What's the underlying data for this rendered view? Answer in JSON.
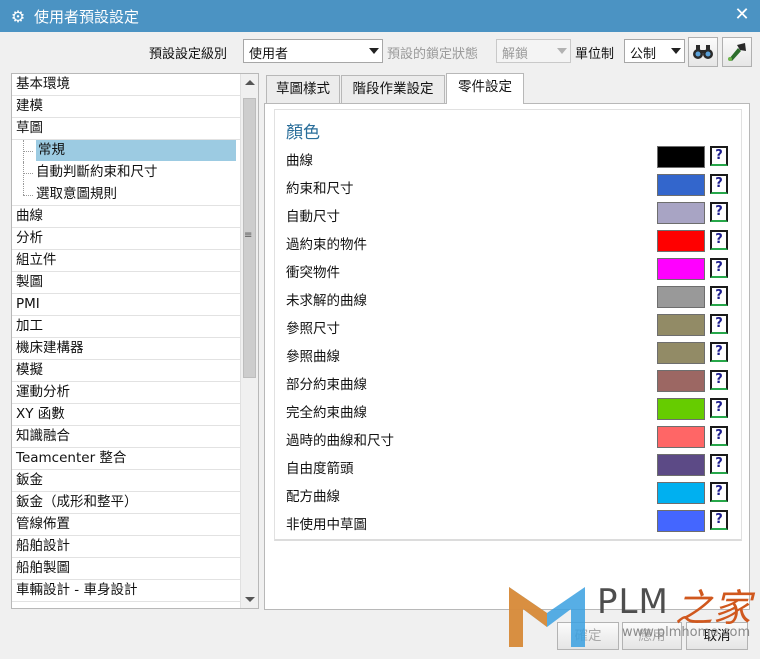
{
  "window": {
    "title": "使用者預設設定"
  },
  "toolbar": {
    "level_label": "預設設定級別",
    "level_value": "使用者",
    "lock_label": "預設的鎖定狀態",
    "lock_value": "解鎖",
    "unit_label": "單位制",
    "unit_value": "公制"
  },
  "tree": {
    "items": [
      {
        "label": "基本環境"
      },
      {
        "label": "建模"
      },
      {
        "label": "草圖"
      },
      {
        "label": "常規"
      },
      {
        "label": "自動判斷約束和尺寸"
      },
      {
        "label": "選取意圖規則"
      },
      {
        "label": "曲線"
      },
      {
        "label": "分析"
      },
      {
        "label": "組立件"
      },
      {
        "label": "製圖"
      },
      {
        "label": "PMI"
      },
      {
        "label": "加工"
      },
      {
        "label": "機床建構器"
      },
      {
        "label": "模擬"
      },
      {
        "label": "運動分析"
      },
      {
        "label": "XY 函數"
      },
      {
        "label": "知識融合"
      },
      {
        "label": "Teamcenter 整合"
      },
      {
        "label": "鈑金"
      },
      {
        "label": "鈑金（成形和整平）"
      },
      {
        "label": "管線佈置"
      },
      {
        "label": "船舶設計"
      },
      {
        "label": "船舶製圖"
      },
      {
        "label": "車輛設計 - 車身設計"
      }
    ]
  },
  "tabs": [
    {
      "label": "草圖樣式"
    },
    {
      "label": "階段作業設定"
    },
    {
      "label": "零件設定"
    }
  ],
  "color_group": {
    "title": "顏色",
    "rows": [
      {
        "label": "曲線",
        "color": "#000000"
      },
      {
        "label": "約束和尺寸",
        "color": "#3366cc"
      },
      {
        "label": "自動尺寸",
        "color": "#a8a4c4"
      },
      {
        "label": "過約束的物件",
        "color": "#ff0000"
      },
      {
        "label": "衝突物件",
        "color": "#ff00ff"
      },
      {
        "label": "未求解的曲線",
        "color": "#999999"
      },
      {
        "label": "參照尺寸",
        "color": "#928b66"
      },
      {
        "label": "參照曲線",
        "color": "#928b66"
      },
      {
        "label": "部分約束曲線",
        "color": "#9c6763"
      },
      {
        "label": "完全約束曲線",
        "color": "#66cc00"
      },
      {
        "label": "過時的曲線和尺寸",
        "color": "#ff6666"
      },
      {
        "label": "自由度箭頭",
        "color": "#5c4a86"
      },
      {
        "label": "配方曲線",
        "color": "#00b0f0"
      },
      {
        "label": "非使用中草圖",
        "color": "#4466ff"
      }
    ],
    "help_glyph": "?"
  },
  "buttons": {
    "ok": "確定",
    "apply": "應用",
    "cancel": "取消"
  },
  "watermark": {
    "brand": "PLM",
    "brand_cn": "之家",
    "url": "www.plmhome.com"
  }
}
